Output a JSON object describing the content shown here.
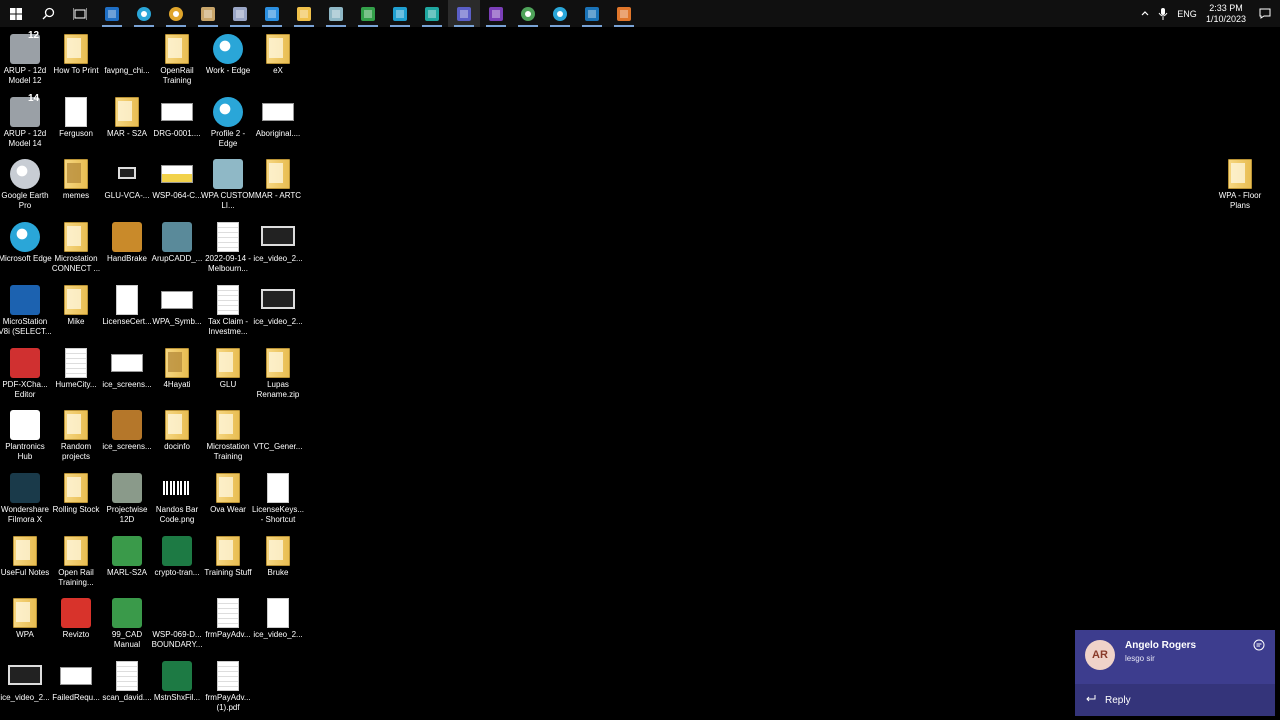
{
  "taskbar": {
    "apps": [
      {
        "icon": "start-icon",
        "color": "#ffffff"
      },
      {
        "icon": "search-icon",
        "color": "#ffffff"
      },
      {
        "icon": "task-view-icon",
        "color": "#ffffff"
      },
      {
        "icon": "outlook-icon",
        "color": "#1f6fc5"
      },
      {
        "icon": "edge-icon",
        "color": "#2aa6d8"
      },
      {
        "icon": "chrome-icon",
        "color": "#e0a52b"
      },
      {
        "icon": "media-player-icon",
        "color": "#c9a66b"
      },
      {
        "icon": "paint-icon",
        "color": "#9aa6c6"
      },
      {
        "icon": "store-icon",
        "color": "#2b8fe0"
      },
      {
        "icon": "file-explorer-icon",
        "color": "#f0c14b"
      },
      {
        "icon": "app-icon",
        "color": "#8fb8c6"
      },
      {
        "icon": "app-green-icon",
        "color": "#33a04a"
      },
      {
        "icon": "sync-icon",
        "color": "#1f9fd0"
      },
      {
        "icon": "app-icon",
        "color": "#1fa7a0"
      },
      {
        "icon": "teams-icon",
        "color": "#5b5fc7"
      },
      {
        "icon": "onenote-icon",
        "color": "#7b3fb8"
      },
      {
        "icon": "chrome-icon",
        "color": "#4fa35a"
      },
      {
        "icon": "edge-icon",
        "color": "#2aa6d8"
      },
      {
        "icon": "microstation-icon",
        "color": "#1a73b8"
      },
      {
        "icon": "app-orange-icon",
        "color": "#e0762b"
      }
    ],
    "tray": {
      "language": "ENG",
      "time": "2:33 PM",
      "date": "1/10/2023"
    }
  },
  "desktop": {
    "columns": [
      [
        {
          "label": "ARUP - 12d Model 12",
          "type": "app",
          "color": "#9aa0a6",
          "badge": "12"
        },
        {
          "label": "ARUP - 12d Model 14",
          "type": "app",
          "color": "#9aa0a6",
          "badge": "14"
        },
        {
          "label": "Google Earth Pro",
          "type": "circle",
          "color": "#c8cdd4"
        },
        {
          "label": "Microsoft Edge",
          "type": "circle",
          "color": "#2aa6d8"
        },
        {
          "label": "MicroStation V8i (SELECT...",
          "type": "app",
          "color": "#1c62b0"
        },
        {
          "label": "PDF-XCha... Editor",
          "type": "app",
          "color": "#d03030"
        },
        {
          "label": "Plantronics Hub",
          "type": "app",
          "color": "#ffffff"
        },
        {
          "label": "Wondershare Filmora X",
          "type": "app",
          "color": "#1a3a4a"
        },
        {
          "label": "UseFul Notes",
          "type": "folder"
        },
        {
          "label": "WPA",
          "type": "folder"
        },
        {
          "label": "ice_video_2...",
          "type": "imgdark"
        }
      ],
      [
        {
          "label": "How To Print",
          "type": "folder"
        },
        {
          "label": "Ferguson",
          "type": "doc"
        },
        {
          "label": "memes",
          "type": "folderdark"
        },
        {
          "label": "Microstation CONNECT ...",
          "type": "folder"
        },
        {
          "label": "Mike",
          "type": "folder"
        },
        {
          "label": "HumeCity...",
          "type": "doclines"
        },
        {
          "label": "Random projects",
          "type": "folder"
        },
        {
          "label": "Rolling Stock",
          "type": "folder"
        },
        {
          "label": "Open Rail Training...",
          "type": "folder"
        },
        {
          "label": "Revizto",
          "type": "app",
          "color": "#d8332b"
        },
        {
          "label": "FailedRequ...",
          "type": "img"
        }
      ],
      [
        {
          "label": "favpng_chi...",
          "type": "none"
        },
        {
          "label": "MAR - S2A",
          "type": "folder"
        },
        {
          "label": "GLU-VCA-...",
          "type": "imgsmall"
        },
        {
          "label": "HandBrake",
          "type": "app",
          "color": "#c98a2a"
        },
        {
          "label": "LicenseCert...",
          "type": "doc"
        },
        {
          "label": "ice_screens...",
          "type": "img"
        },
        {
          "label": "ice_screens...",
          "type": "app",
          "color": "#b5772a"
        },
        {
          "label": "Projectwise 12D",
          "type": "app",
          "color": "#8a9a8a"
        },
        {
          "label": "MARL-S2A",
          "type": "app",
          "color": "#3a9a4a"
        },
        {
          "label": "99_CAD Manual",
          "type": "app",
          "color": "#3a9a4a"
        },
        {
          "label": "scan_david....",
          "type": "doclines"
        }
      ],
      [
        {
          "label": "OpenRail Training",
          "type": "folder"
        },
        {
          "label": "DRG-0001....",
          "type": "img"
        },
        {
          "label": "WSP-064-C...",
          "type": "imgyellow"
        },
        {
          "label": "ArupCADD_...",
          "type": "app",
          "color": "#5a8a9a"
        },
        {
          "label": "WPA_Symb...",
          "type": "img"
        },
        {
          "label": "4Hayati",
          "type": "folderdark"
        },
        {
          "label": "docinfo",
          "type": "folder"
        },
        {
          "label": "Nandos Bar Code.png",
          "type": "barcode"
        },
        {
          "label": "crypto-tran...",
          "type": "app",
          "color": "#1d7a44"
        },
        {
          "label": "WSP-069-D... BOUNDARY...",
          "type": "none"
        },
        {
          "label": "MstnShxFil...",
          "type": "app",
          "color": "#1d7a44"
        }
      ],
      [
        {
          "label": "Work - Edge",
          "type": "circle",
          "color": "#2aa6d8"
        },
        {
          "label": "Profile 2 - Edge",
          "type": "circle",
          "color": "#2aa6d8"
        },
        {
          "label": "WPA CUSTOM LI...",
          "type": "app",
          "color": "#8fb8c6"
        },
        {
          "label": "2022-09-14 - Melbourn...",
          "type": "doclines"
        },
        {
          "label": "Tax Claim - Investme...",
          "type": "doclines"
        },
        {
          "label": "GLU",
          "type": "folder"
        },
        {
          "label": "Microstation Training",
          "type": "folder"
        },
        {
          "label": "Ova Wear",
          "type": "folder"
        },
        {
          "label": "Training Stuff",
          "type": "folder"
        },
        {
          "label": "frmPayAdv...",
          "type": "doclines"
        },
        {
          "label": "frmPayAdv... (1).pdf",
          "type": "doclines"
        }
      ],
      [
        {
          "label": "eX",
          "type": "folder"
        },
        {
          "label": "Aboriginal....",
          "type": "img"
        },
        {
          "label": "MAR - ARTC",
          "type": "folder"
        },
        {
          "label": "ice_video_2...",
          "type": "imgdark"
        },
        {
          "label": "ice_video_2...",
          "type": "imgdark"
        },
        {
          "label": "Lupas Rename.zip",
          "type": "folder"
        },
        {
          "label": "VTC_Gener...",
          "type": "none"
        },
        {
          "label": "LicenseKeys... - Shortcut",
          "type": "doc"
        },
        {
          "label": "Bruke",
          "type": "folder"
        },
        {
          "label": "ice_video_2...",
          "type": "doc"
        }
      ]
    ],
    "right_icon": {
      "label": "WPA - Floor Plans",
      "type": "folder"
    }
  },
  "toast": {
    "initials": "AR",
    "sender": "Angelo Rogers",
    "message": "lesgo sir",
    "reply_label": "Reply"
  }
}
